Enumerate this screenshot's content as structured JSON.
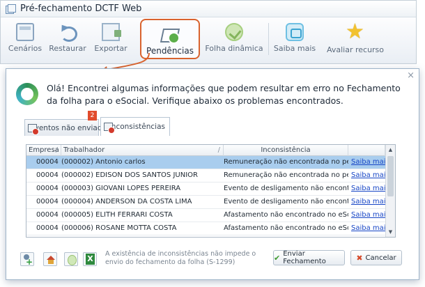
{
  "window": {
    "title": "Pré-fechamento DCTF Web"
  },
  "toolbar": {
    "cenarios": "Cenários",
    "restaurar": "Restaurar",
    "exportar": "Exportar",
    "pendencias": "Pendências",
    "folha_dinamica": "Folha dinâmica",
    "saiba_mais": "Saiba mais",
    "avaliar_recurso": "Avaliar recurso"
  },
  "dialog": {
    "close": "×",
    "message": "Olá! Encontrei algumas informações que podem resultar em erro no Fechamento da folha para o eSocial. Verifique abaixo os problemas encontrados.",
    "tabs": {
      "eventos_nao_enviados": "Eventos não enviados",
      "inconsistencias": "Inconsistências",
      "badge": "2"
    },
    "grid": {
      "headers": {
        "empresa": "Empresa",
        "trabalhador": "Trabalhador",
        "inconsistencia": "Inconsistência",
        "sort_mark": "/"
      },
      "rows": [
        {
          "empresa": "00004",
          "trabalhador": "(000002) Antonio carlos",
          "inconsistencia": "Remuneração não encontrada no período",
          "acao": "Saiba mais"
        },
        {
          "empresa": "00004",
          "trabalhador": "(000002) EDISON DOS SANTOS JUNIOR",
          "inconsistencia": "Remuneração não encontrada no período",
          "acao": "Saiba mais"
        },
        {
          "empresa": "00004",
          "trabalhador": "(000003) GIOVANI LOPES PEREIRA",
          "inconsistencia": "Evento de desligamento não encontrado",
          "acao": "Saiba mais"
        },
        {
          "empresa": "00004",
          "trabalhador": "(000004) ANDERSON DA COSTA LIMA",
          "inconsistencia": "Evento de desligamento não encontrado",
          "acao": "Saiba mais"
        },
        {
          "empresa": "00004",
          "trabalhador": "(000005) ELITH FERRARI COSTA",
          "inconsistencia": "Afastamento não encontrado no eSocial",
          "acao": "Saiba mais"
        },
        {
          "empresa": "00004",
          "trabalhador": "(000006) ROSANE MOTTA COSTA",
          "inconsistencia": "Afastamento não encontrado no eSocial",
          "acao": "Saiba mais"
        }
      ],
      "scroll_up": "▲",
      "scroll_down": "▼"
    },
    "footer": {
      "note": "A existência de inconsistências não impede o envio do fechamento da folha (S-1299)",
      "enviar": "Enviar Fechamento",
      "cancelar": "Cancelar"
    }
  },
  "icons": {
    "cenarios": "window-icon",
    "restaurar": "undo-arrow-icon",
    "exportar": "export-icon",
    "pendencias": "document-check-icon",
    "folha_dinamica": "dynamic-sheet-icon",
    "saiba_mais": "info-chat-icon",
    "avaliar_recurso": "star-icon"
  },
  "colors": {
    "highlight_border": "#d9632e",
    "selected_row": "#a9cdee",
    "link": "#1746c6",
    "badge": "#e14b2c"
  }
}
